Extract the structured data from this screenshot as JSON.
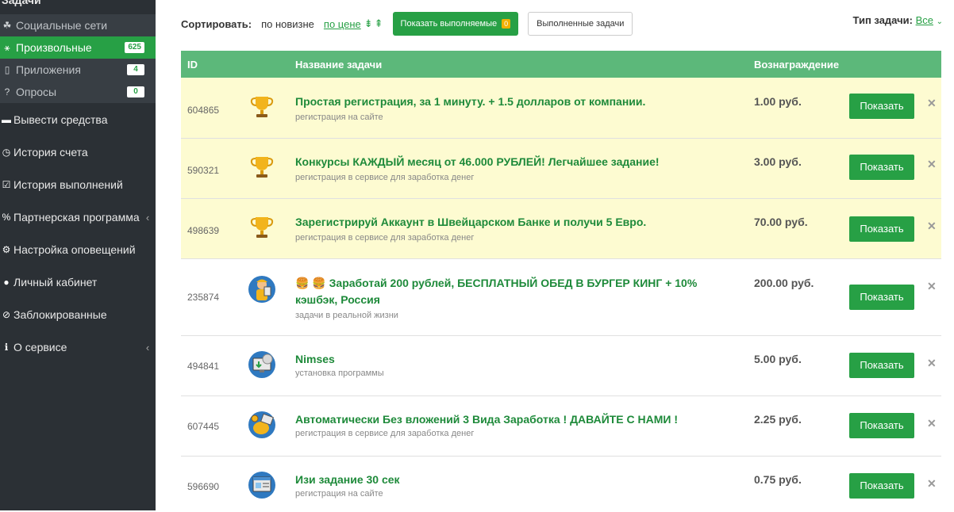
{
  "sidebar": {
    "top_cut": "Задачи",
    "subitems": [
      {
        "icon": "share-icon",
        "glyph": "☘",
        "label": "Социальные сети",
        "badge": ""
      },
      {
        "icon": "shapes-icon",
        "glyph": "⚹",
        "label": "Произвольные",
        "badge": "625"
      },
      {
        "icon": "mobile-icon",
        "glyph": "▯",
        "label": "Приложения",
        "badge": "4"
      },
      {
        "icon": "question-icon",
        "glyph": "?",
        "label": "Опросы",
        "badge": "0"
      }
    ],
    "menu": [
      {
        "icon": "minus-icon",
        "glyph": "▬",
        "label": "Вывести средства",
        "chev": ""
      },
      {
        "icon": "clock-icon",
        "glyph": "◷",
        "label": "История счета",
        "chev": ""
      },
      {
        "icon": "checkbox-icon",
        "glyph": "☑",
        "label": "История выполнений",
        "chev": ""
      },
      {
        "icon": "percent-icon",
        "glyph": "%",
        "label": "Партнерская программа",
        "chev": "‹"
      },
      {
        "icon": "cogs-icon",
        "glyph": "⚙",
        "label": "Настройка оповещений",
        "chev": ""
      },
      {
        "icon": "user-icon",
        "glyph": "●",
        "label": "Личный кабинет",
        "chev": ""
      },
      {
        "icon": "ban-icon",
        "glyph": "⊘",
        "label": "Заблокированные",
        "chev": ""
      },
      {
        "icon": "info-icon",
        "glyph": "ℹ",
        "label": "О сервисе",
        "chev": "‹"
      }
    ]
  },
  "toolbar": {
    "sort_label": "Сортировать:",
    "sort_newest": "по новизне",
    "sort_price": "по цене",
    "show_running_label": "Показать выполняемые",
    "show_running_count": "0",
    "done_label": "Выполненные задачи",
    "task_type_label": "Тип задачи:",
    "task_type_value": "Все"
  },
  "table": {
    "headers": {
      "id": "ID",
      "name": "Название задачи",
      "reward": "Вознаграждение"
    },
    "rows": [
      {
        "id": "604865",
        "icon": "trophy-icon",
        "title": "Простая регистрация, за 1 минуту. + 1.5 долларов от компании.",
        "subtitle": "регистрация на сайте",
        "reward": "1.00 руб.",
        "button": "Показать",
        "highlight": true
      },
      {
        "id": "590321",
        "icon": "trophy-icon",
        "title": "Конкурсы КАЖДЫЙ месяц от 46.000 РУБЛЕЙ! Легчайшее задание!",
        "subtitle": "регистрация в сервисе для заработка денег",
        "reward": "3.00 руб.",
        "button": "Показать",
        "highlight": true
      },
      {
        "id": "498639",
        "icon": "trophy-icon",
        "title": "Зарегистрируй Аккаунт в Швейцарском Банке и получи 5 Евро.",
        "subtitle": "регистрация в сервисе для заработка денег",
        "reward": "70.00 руб.",
        "button": "Показать",
        "highlight": true
      },
      {
        "id": "235874",
        "icon": "worker-icon",
        "title": "🍔 🍔 Заработай 200 рублей, БЕСПЛАТНЫЙ ОБЕД В БУРГЕР КИНГ + 10% кэшбэк, Россия",
        "subtitle": "задачи в реальной жизни",
        "reward": "200.00 руб.",
        "button": "Показать",
        "highlight": false
      },
      {
        "id": "494841",
        "icon": "install-icon",
        "title": "Nimses",
        "subtitle": "установка программы",
        "reward": "5.00 руб.",
        "button": "Показать",
        "highlight": false
      },
      {
        "id": "607445",
        "icon": "money-icon",
        "title": "Автоматически Без вложений 3 Вида Заработка ! ДАВАЙТЕ С НАМИ !",
        "subtitle": "регистрация в сервисе для заработка денег",
        "reward": "2.25 руб.",
        "button": "Показать",
        "highlight": false
      },
      {
        "id": "596690",
        "icon": "website-icon",
        "title": "Изи задание 30 сек",
        "subtitle": "регистрация на сайте",
        "reward": "0.75 руб.",
        "button": "Показать",
        "highlight": false
      }
    ]
  },
  "colors": {
    "accent": "#27a045",
    "header": "#5cb87a",
    "highlight": "#fdfbd1",
    "sidebar": "#2b3035"
  }
}
